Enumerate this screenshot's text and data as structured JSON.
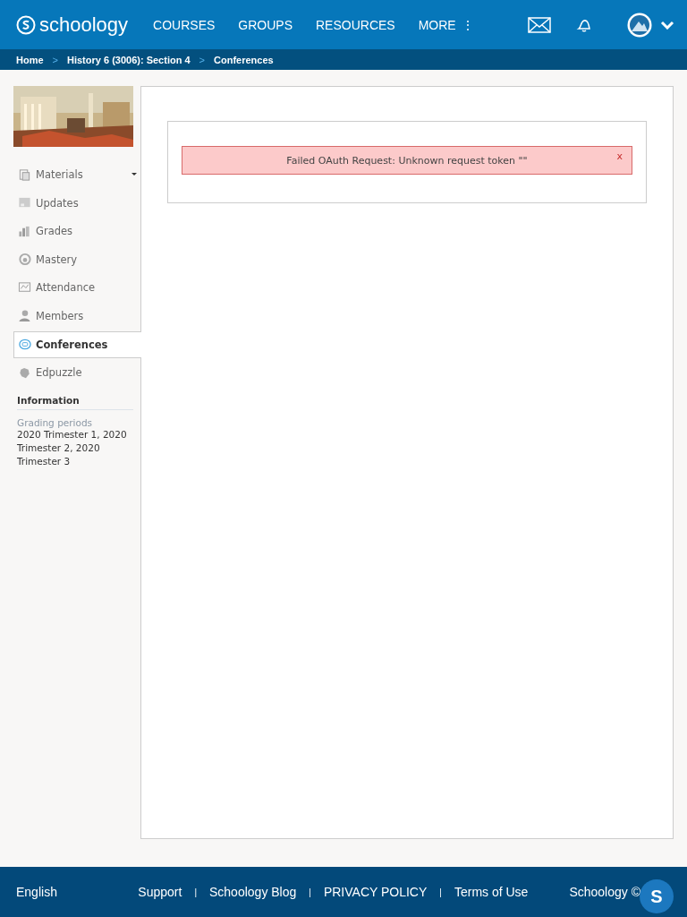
{
  "header": {
    "logo": "schoology",
    "nav": [
      "COURSES",
      "GROUPS",
      "RESOURCES",
      "MORE"
    ],
    "more_icon": "⋮"
  },
  "breadcrumb": [
    "Home",
    "History 6 (3006): Section 4",
    "Conferences"
  ],
  "breadcrumb_separator": ">",
  "sidebar": {
    "items": [
      {
        "label": "Materials",
        "selected": false,
        "has_menu": true
      },
      {
        "label": "Updates",
        "selected": false,
        "has_menu": false
      },
      {
        "label": "Grades",
        "selected": false,
        "has_menu": false
      },
      {
        "label": "Mastery",
        "selected": false,
        "has_menu": false
      },
      {
        "label": "Attendance",
        "selected": false,
        "has_menu": false
      },
      {
        "label": "Members",
        "selected": false,
        "has_menu": false
      },
      {
        "label": "Conferences",
        "selected": true,
        "has_menu": false
      },
      {
        "label": "Edpuzzle",
        "selected": false,
        "has_menu": false
      }
    ],
    "info_title": "Information",
    "info_label": "Grading periods",
    "info_lines": [
      "2020 Trimester 1, 2020",
      "Trimester 2, 2020",
      "Trimester 3"
    ]
  },
  "alert": {
    "message": "Failed OAuth Request: Unknown request token \"\"",
    "close": "x"
  },
  "footer": {
    "language": "English",
    "links": [
      "Support",
      "Schoology Blog",
      "PRIVACY POLICY",
      "Terms of Use"
    ],
    "separator": "|",
    "copyright": "Schoology ©",
    "chat_button": "S"
  }
}
